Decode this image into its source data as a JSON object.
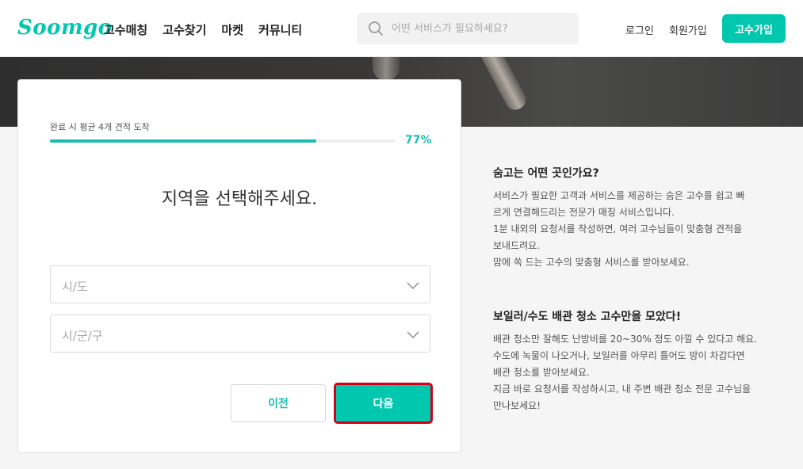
{
  "header": {
    "logo": "Soomgo",
    "nav": [
      "고수매칭",
      "고수찾기",
      "마켓",
      "커뮤니티"
    ],
    "search_placeholder": "어떤 서비스가 필요하세요?",
    "login": "로그인",
    "register": "회원가입",
    "pro_signup": "고수가입"
  },
  "form": {
    "progress_label": "완료 시 평균 4개 견적 도착",
    "progress_percent": "77%",
    "progress_value": 0.77,
    "title": "지역을 선택해주세요.",
    "select_city": "시/도",
    "select_district": "시/군/구",
    "prev_button": "이전",
    "next_button": "다음"
  },
  "info": {
    "h1": "숨고는 어떤 곳인가요?",
    "p1": [
      "서비스가 필요한 고객과 서비스를 제공하는 숨은 고수를 쉽고 빠",
      "르게 연결해드리는 전문가 매칭 서비스입니다.",
      "1분 내외의 요청서를 작성하면, 여러 고수님들이 맞춤형 견적을",
      "보내드려요.",
      "맘에 쏙 드는 고수의 맞춤형 서비스를 받아보세요."
    ],
    "h2": "보일러/수도 배관 청소 고수만을 모았다!",
    "p2": [
      "배관 청소만 잘해도 난방비를 20~30% 정도 아낄 수 있다고 해요.",
      "수도에 녹물이 나오거나, 보일러를 아무리 틀어도 방이 차갑다면",
      "배관 청소를 받아보세요.",
      "지금 바로 요청서를 작성하시고, 내 주변 배관 청소 전문 고수님을",
      "만나보세요!"
    ]
  },
  "colors": {
    "brand": "#00c7ae",
    "progress": "#1bbcb0",
    "highlight_border": "#d0021b"
  }
}
